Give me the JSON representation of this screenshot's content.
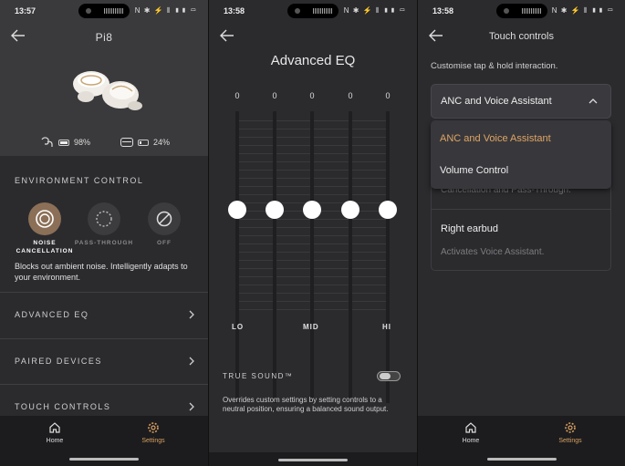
{
  "screens": [
    {
      "status": {
        "time": "13:57",
        "icons": "N ✱ ⚡ ⦀ ▮▮ ▭"
      },
      "title": "Pi8",
      "battery": {
        "earbuds": "98%",
        "case": "24%",
        "earbuds_level": 0.98,
        "case_level": 0.24
      },
      "environment": {
        "heading": "ENVIRONMENT CONTROL",
        "modes": [
          "NOISE CANCELLATION",
          "PASS-THROUGH",
          "OFF"
        ],
        "active_mode": "NOISE CANCELLATION",
        "description": "Blocks out ambient noise. Intelligently adapts to your environment."
      },
      "menu": [
        "ADVANCED EQ",
        "PAIRED DEVICES",
        "TOUCH CONTROLS"
      ],
      "nav": {
        "home": "Home",
        "settings": "Settings",
        "active": "Settings"
      }
    },
    {
      "status": {
        "time": "13:58",
        "icons": "N ✱ ⚡ ⦀ ▮▮ ▭"
      },
      "title": "Advanced EQ",
      "eq_values": [
        "0",
        "0",
        "0",
        "0",
        "0"
      ],
      "eq_axis": {
        "low": "LO",
        "mid": "MID",
        "high": "HI"
      },
      "true_sound": {
        "label": "TRUE SOUND™",
        "enabled": false,
        "description": "Overrides custom settings by setting controls to a neutral position, ensuring a balanced sound output."
      }
    },
    {
      "status": {
        "time": "13:58",
        "icons": "N ✱ ⚡ ⦀ ▮▮ ▭"
      },
      "title": "Touch controls",
      "subtitle": "Customise tap & hold interaction.",
      "select_value": "ANC and Voice Assistant",
      "dropdown": [
        "ANC and Voice Assistant",
        "Volume Control"
      ],
      "left_desc_partial": "Cancellation and Pass-Through.",
      "right_earbud": {
        "label": "Right earbud",
        "desc": "Activates Voice Assistant."
      },
      "nav": {
        "home": "Home",
        "settings": "Settings",
        "active": "Settings"
      }
    }
  ],
  "colors": {
    "accent": "#d8a060",
    "background": "#2b2b2e",
    "header": "#3a3a3c",
    "nav": "#1c1c1e"
  }
}
